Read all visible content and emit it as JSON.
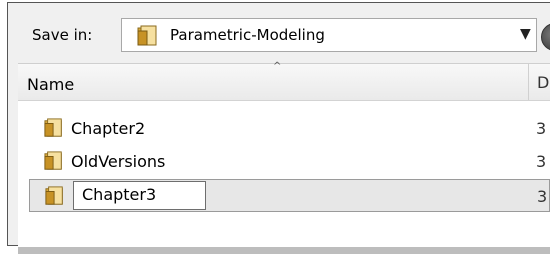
{
  "window": {
    "title": ""
  },
  "save_in": {
    "label": "Save in:",
    "folder": "Parametric-Modeling",
    "dropdown_icon": "chevron-down-icon",
    "folder_icon": "folder-icon"
  },
  "file_list": {
    "columns": [
      "Name",
      "D"
    ],
    "sort_indicator": "^",
    "rows": [
      {
        "name": "Chapter2",
        "trailing": "3",
        "icon": "folder-icon"
      },
      {
        "name": "OldVersions",
        "trailing": "3",
        "icon": "folder-icon"
      },
      {
        "name": "Chapter3",
        "trailing": "3",
        "icon": "folder-icon",
        "editing": true
      }
    ]
  },
  "colors": {
    "dialog_bg": "#f0f0f0",
    "list_bg": "#ffffff",
    "selected_row": "#e7e7e7",
    "border": "#9a9a9a"
  }
}
